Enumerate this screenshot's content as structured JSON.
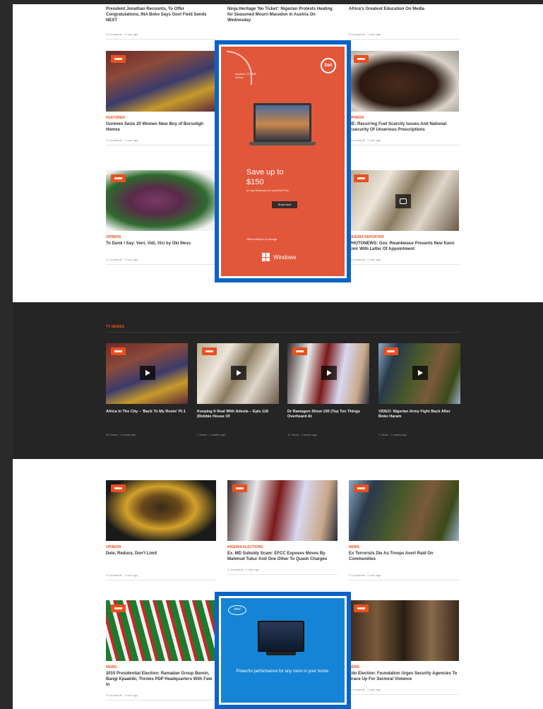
{
  "top_partial": [
    {
      "title": "President Jonathan Recounts, To Offer Congratulations, INA Boko Says Govt Field Sends NEXT"
    },
    {
      "title": "Ninja Heritage 'No Ticket': Nigerian Protests Heating for Seasoned Mourn Macedon in Austria On Wednesday"
    },
    {
      "title": "Africa's Greatest Education On Media"
    }
  ],
  "top_partial_meta": "5 Comments · 1 hour ago",
  "stories_top": [
    {
      "category": "Featured",
      "title": "Gunmen Seize 20 Women Near Boy of Borsoligh Homes",
      "meta": "3 Comments · 1 hour ago",
      "thumb": "crowd"
    },
    {
      "category": "Opinion",
      "title": "RE: Recurring Fuel Scarcity Issues And National Insecurity Of Unserious Prescriptions",
      "meta": "3 Comments · 1 hour ago",
      "thumb": "man"
    },
    {
      "category": "Opinion",
      "title": "To Dunk I Say: Veni, Vidi, Vici by Oki Illess",
      "meta": "3 Comments · 1 hour ago",
      "thumb": "woman"
    },
    {
      "category": "Nigeria Reporter",
      "title": "PHOTONEWS: Gov. Rwankwaso Presents New Kano Emir With Letter Of Appointment",
      "meta": "3 Comments · 1 hour ago",
      "thumb": "white"
    }
  ],
  "ad_dell": {
    "brand": "Dell",
    "kicker": "Inspiron 13 7000 Series",
    "headline": "Save up to",
    "amount": "$150",
    "sub": "on top Windows 8.1 and Dell PCs",
    "cta": "Shop Now",
    "footer": "Offers subject to change.",
    "windows": "Windows"
  },
  "videos": {
    "section_label": "TV Series",
    "items": [
      {
        "title": "Africa In The City – 'Back To My Roots' Pt.1",
        "meta": "3K Views · 2 weeks ago",
        "thumb": "crowd"
      },
      {
        "title": "Keeping It Real With Adeola – Epis 118 (Robbie House Of",
        "meta": "7 Views · 2 weeks ago",
        "thumb": "white"
      },
      {
        "title": "Dr Ramagon Show 100 (Top Ten Things Overheard At",
        "meta": "11 Views · 2 weeks ago",
        "thumb": "group"
      },
      {
        "title": "VIDEO: Nigerian Army Fight Back After Boko Haram",
        "meta": "2 Views · 2 weeks ago",
        "thumb": "army"
      }
    ]
  },
  "stories_bottom": [
    {
      "category": "Opinion",
      "title": "Dele, Reduce, Don't Limit",
      "meta": "3 Comments · 1 hour ago",
      "thumb": "smile"
    },
    {
      "category": "Nigeria Elections",
      "title": "Ex. MD Subsidy Scam: EFCC Exposes Moves By Mahmud Tukur And One Other To Quash Charges",
      "meta": "3 Comments · 1 hour ago",
      "thumb": "group"
    },
    {
      "category": "News",
      "title": "Ex Terrorists Die As Troops Avert Raid On Communities",
      "meta": "3 Comments · 1 hour ago",
      "thumb": "army"
    },
    {
      "category": "News",
      "title": "2015 Presidential Election: Ramadan Group Berein, Bangi Kpaakiki, Throws PDP Headquarters With Fate In",
      "meta": "3 Comments · 1 hour ago",
      "thumb": "flags"
    },
    {
      "category": "News",
      "title": "Edo Election: Foundation Urges Security Agencies To Brace Up For Sectoral Violence",
      "meta": "3 Comments · 1 hour ago",
      "thumb": "faces"
    }
  ],
  "ad_intel": {
    "brand": "intel",
    "text": "Powerful performance for any room in your home."
  },
  "colors": {
    "accent": "#e8501e",
    "highlight_border": "#0a63c9",
    "dell_bg": "#e2573a",
    "intel_bg": "#1584d6"
  }
}
